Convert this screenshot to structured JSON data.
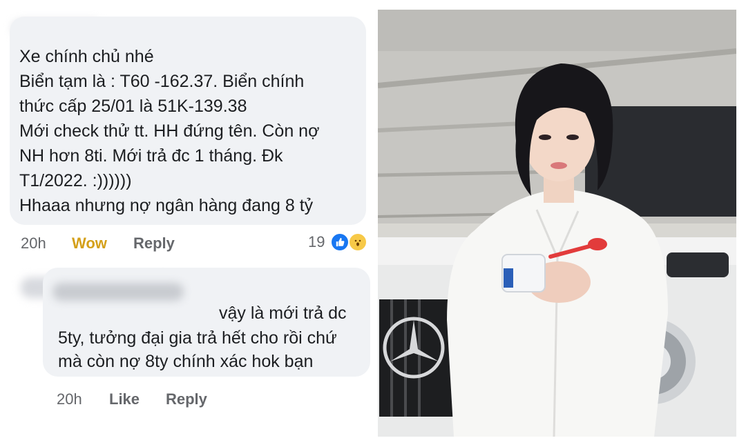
{
  "comment1": {
    "lines": [
      "Xe chính chủ nhé",
      "Biển tạm là : T60 -162.37. Biển chính",
      "thức cấp 25/01 là 51K-139.38",
      "Mới check thử tt. HH đứng tên. Còn nợ",
      "NH hơn 8ti. Mới trả đc 1 tháng. Đk",
      "T1/2022. :))))))",
      "Hhaaa nhưng nợ ngân hàng đang 8 tỷ"
    ],
    "time": "20h",
    "reaction_label": "Wow",
    "reply_label": "Reply",
    "reaction_count": "19"
  },
  "comment2": {
    "lines": [
      "vậy là mới trả dc",
      "5ty, tưởng đại gia trả hết cho rồi chứ",
      "mà còn nợ 8ty chính xác hok bạn"
    ],
    "time": "20h",
    "like_label": "Like",
    "reply_label": "Reply"
  },
  "photo": {
    "scene": "woman-in-white-shirt-with-white-mercedes"
  },
  "colors": {
    "bubble": "#f0f2f5",
    "text": "#1c1e21",
    "meta": "#65676b",
    "wow": "#d4a01a",
    "like_blue": "#1877f2"
  }
}
